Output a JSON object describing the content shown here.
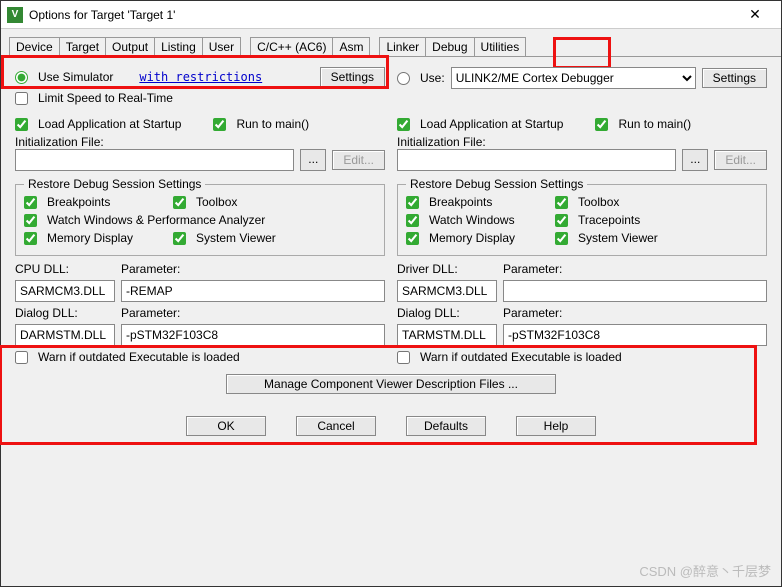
{
  "window": {
    "title": "Options for Target 'Target 1'"
  },
  "tabs": [
    "Device",
    "Target",
    "Output",
    "Listing",
    "User",
    "C/C++ (AC6)",
    "Asm",
    "Linker",
    "Debug",
    "Utilities"
  ],
  "left": {
    "useSimulator": "Use Simulator",
    "restrictionsLink": "with restrictions",
    "settingsBtn": "Settings",
    "limitSpeed": "Limit Speed to Real-Time",
    "loadApp": "Load Application at Startup",
    "runMain": "Run to main()",
    "initFileLabel": "Initialization File:",
    "initFileValue": "",
    "editBtn": "Edit...",
    "restoreLegend": "Restore Debug Session Settings",
    "breakpoints": "Breakpoints",
    "toolbox": "Toolbox",
    "watchPerf": "Watch Windows & Performance Analyzer",
    "memDisplay": "Memory Display",
    "sysViewer": "System Viewer",
    "cpuDllLabel": "CPU DLL:",
    "paramLabel": "Parameter:",
    "cpuDll": "SARMCM3.DLL",
    "cpuParam": "-REMAP",
    "dialogDllLabel": "Dialog DLL:",
    "dialogDll": "DARMSTM.DLL",
    "dialogParam": "-pSTM32F103C8",
    "warnOutdated": "Warn if outdated Executable is loaded"
  },
  "right": {
    "use": "Use:",
    "debuggerSelected": "ULINK2/ME Cortex Debugger",
    "settingsBtn": "Settings",
    "loadApp": "Load Application at Startup",
    "runMain": "Run to main()",
    "initFileLabel": "Initialization File:",
    "initFileValue": "",
    "editBtn": "Edit...",
    "restoreLegend": "Restore Debug Session Settings",
    "breakpoints": "Breakpoints",
    "toolbox": "Toolbox",
    "watchWin": "Watch Windows",
    "tracepoints": "Tracepoints",
    "memDisplay": "Memory Display",
    "sysViewer": "System Viewer",
    "driverDllLabel": "Driver DLL:",
    "paramLabel": "Parameter:",
    "driverDll": "SARMCM3.DLL",
    "driverParam": "",
    "dialogDllLabel": "Dialog DLL:",
    "dialogDll": "TARMSTM.DLL",
    "dialogParam": "-pSTM32F103C8",
    "warnOutdated": "Warn if outdated Executable is loaded"
  },
  "manageBtn": "Manage Component Viewer Description Files ...",
  "buttons": {
    "ok": "OK",
    "cancel": "Cancel",
    "defaults": "Defaults",
    "help": "Help"
  },
  "watermark": "CSDN @醉意丶千层梦"
}
